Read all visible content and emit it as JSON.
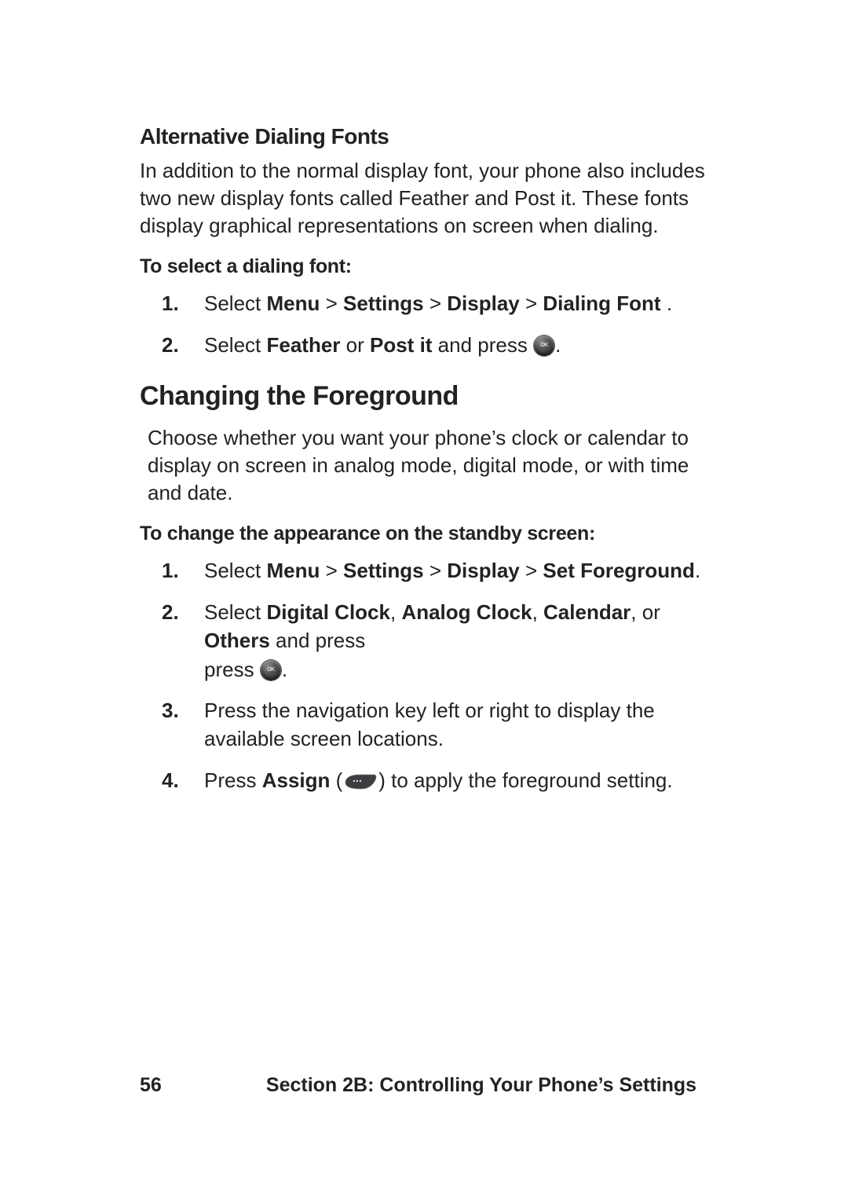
{
  "section1": {
    "heading": "Alternative Dialing Fonts",
    "paragraph": "In addition to the normal display font, your phone also includes two new display fonts called Feather and Post it. These fonts display graphical representations on screen when dialing.",
    "leadin": "To select a dialing font:",
    "steps": {
      "s1_num": "1.",
      "s1_a": "Select ",
      "s1_menu": "Menu",
      "s1_sep": " > ",
      "s1_settings": "Settings",
      "s1_display": "Display",
      "s1_dialingfont": "Dialing Font",
      "s1_end": " .",
      "s2_num": "2.",
      "s2_a": "Select ",
      "s2_feather": "Feather",
      "s2_or": " or ",
      "s2_postit": "Post it",
      "s2_b": " and press ",
      "s2_end": "."
    }
  },
  "section2": {
    "heading": "Changing the Foreground",
    "paragraph": "Choose whether you want your phone’s clock or calendar to display on screen in analog mode, digital mode, or with time and date.",
    "leadin": "To change the appearance on the standby screen:",
    "steps": {
      "s1_num": "1.",
      "s1_a": "Select ",
      "s1_menu": "Menu",
      "s1_sep": " > ",
      "s1_settings": "Settings",
      "s1_display": "Display",
      "s1_setfg": "Set Foreground",
      "s1_end": ".",
      "s2_num": "2.",
      "s2_a": "Select ",
      "s2_digital": "Digital Clock",
      "s2_c1": ", ",
      "s2_analog": "Analog Clock",
      "s2_c2": ", ",
      "s2_calendar": "Calendar",
      "s2_c3": ", or ",
      "s2_others": "Others",
      "s2_b": " and press ",
      "s2_end": ".",
      "s3_num": "3.",
      "s3_text": "Press the navigation key left or right to display the available screen locations.",
      "s4_num": "4.",
      "s4_a": "Press ",
      "s4_assign": "Assign",
      "s4_b": " (",
      "s4_c": ") to apply the foreground setting."
    }
  },
  "footer": {
    "page": "56",
    "text": "Section 2B: Controlling Your Phone’s Settings"
  }
}
